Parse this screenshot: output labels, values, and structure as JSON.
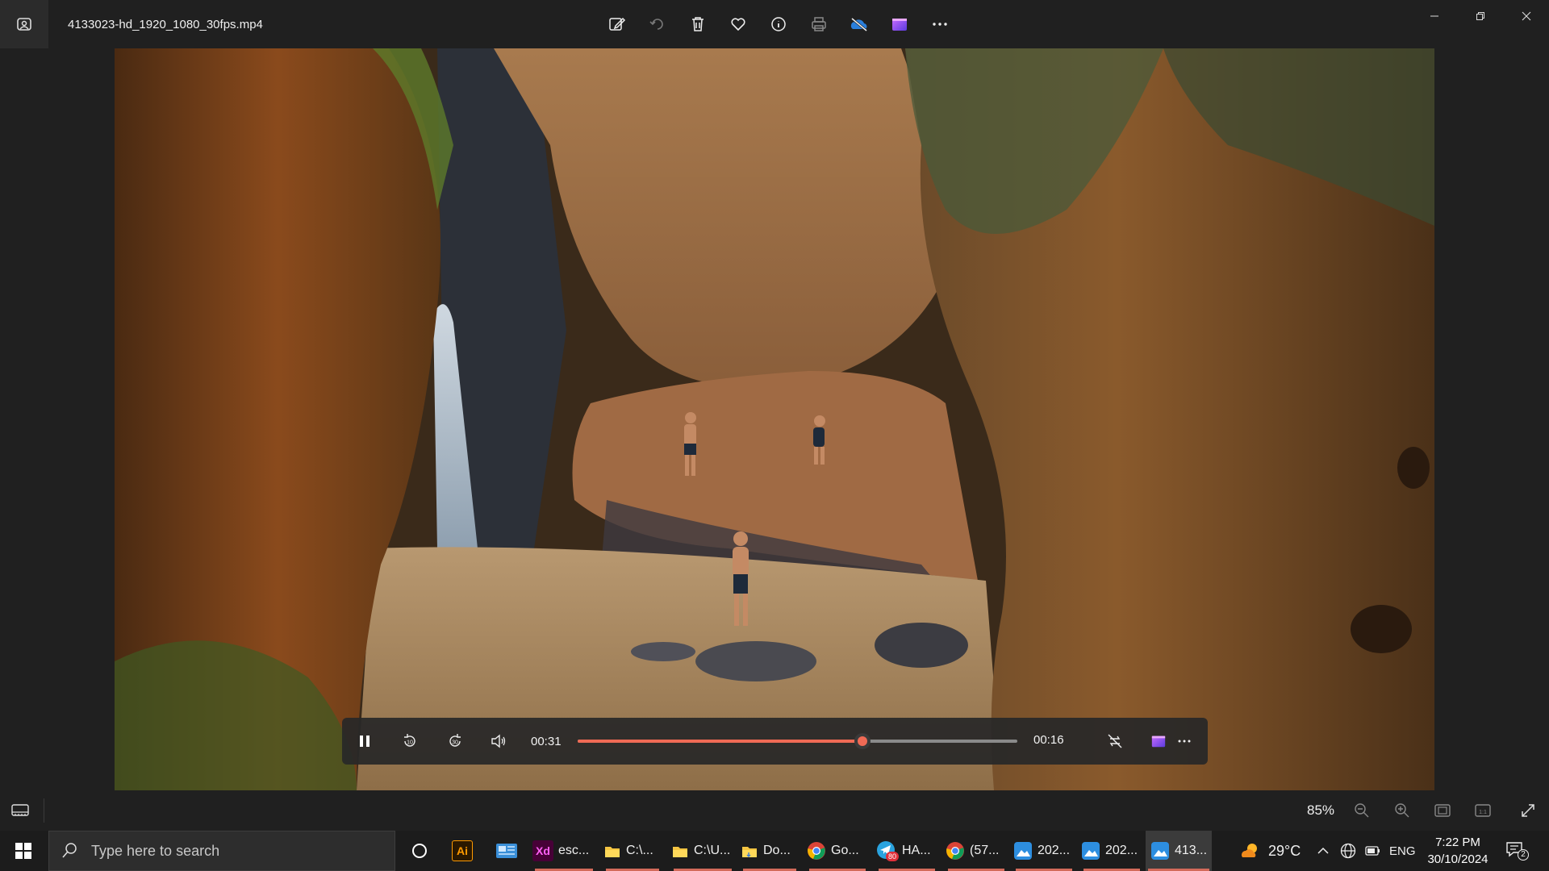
{
  "window": {
    "title": "4133023-hd_1920_1080_30fps.mp4"
  },
  "toolbar": {
    "items": [
      "edit-image-icon",
      "rotate-icon",
      "delete-icon",
      "favorite-icon",
      "info-icon",
      "print-icon",
      "onedrive-icon",
      "clipchamp-icon",
      "more-icon"
    ]
  },
  "player": {
    "elapsed": "00:31",
    "remaining": "00:16",
    "progress": 0.648,
    "accent": "#ef6a55"
  },
  "statusbar": {
    "zoom": "85%"
  },
  "taskbar": {
    "search_placeholder": "Type here to search",
    "items": [
      {
        "label": "esc...",
        "icon": "xd-icon"
      },
      {
        "label": "C:\\...",
        "icon": "folder-icon"
      },
      {
        "label": "C:\\U...",
        "icon": "folder-icon"
      },
      {
        "label": "Do...",
        "icon": "folder-icon"
      },
      {
        "label": "Go...",
        "icon": "chrome-icon"
      },
      {
        "label": "HA...",
        "icon": "telegram-icon",
        "badge": "80"
      },
      {
        "label": "(57...",
        "icon": "chrome-icon"
      },
      {
        "label": "202...",
        "icon": "photos-icon"
      },
      {
        "label": "202...",
        "icon": "photos-icon"
      },
      {
        "label": "413...",
        "icon": "photos-icon"
      }
    ],
    "ai_label": "Ai",
    "xd_label": "Xd",
    "weather": "29°C",
    "language": "ENG",
    "time": "7:22 PM",
    "date": "30/10/2024",
    "notification_count": "2"
  }
}
